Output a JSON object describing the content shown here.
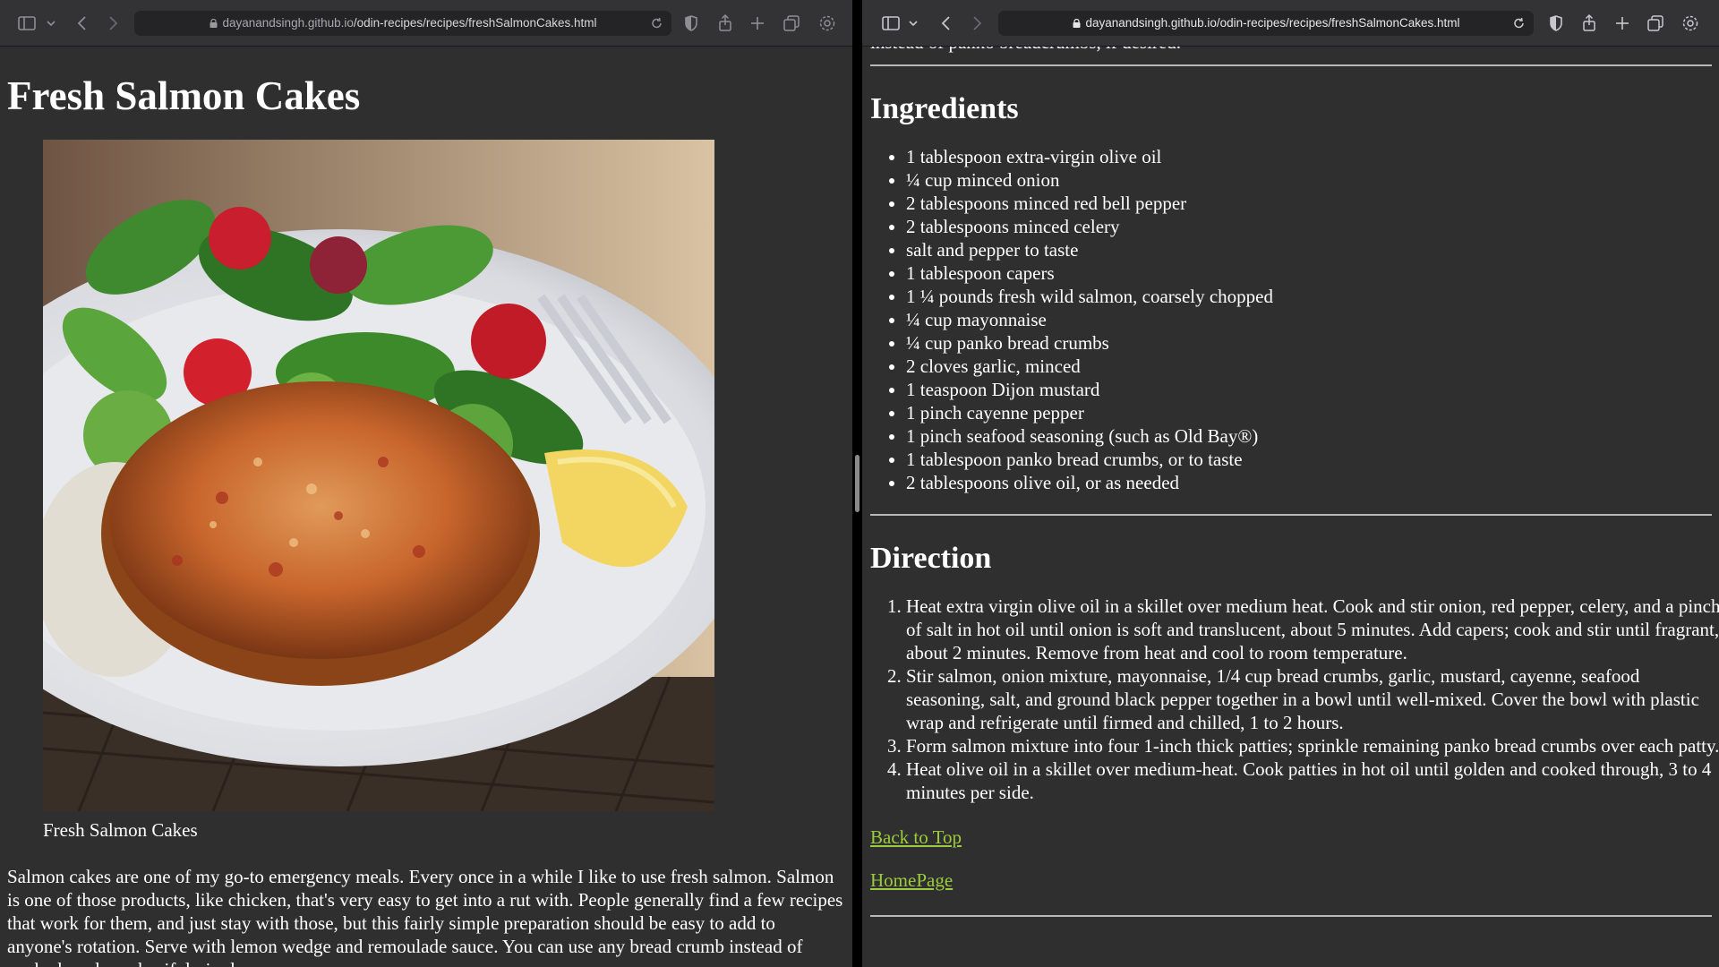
{
  "browser": {
    "left": {
      "url_domain": "dayanandsingh.github.io",
      "url_path": "/odin-recipes/recipes/freshSalmonCakes.html"
    },
    "right": {
      "url_domain": "dayanandsingh.github.io",
      "url_path": "/odin-recipes/recipes/freshSalmonCakes.html"
    }
  },
  "icons": [
    "sidebar-icon",
    "chevron-down-icon",
    "back-icon",
    "forward-icon",
    "lock-icon",
    "reload-icon",
    "shield-icon",
    "share-icon",
    "new-tab-icon",
    "tabs-overview-icon",
    "settings-icon"
  ],
  "colors": {
    "link": "#9ccc3c",
    "page_bg": "#2f2f2f",
    "text": "#ffffff"
  },
  "page": {
    "title": "Fresh Salmon Cakes",
    "image_caption": "Fresh Salmon Cakes",
    "intro": "Salmon cakes are one of my go-to emergency meals. Every once in a while I like to use fresh salmon. Salmon is one of those products, like chicken, that's very easy to get into a rut with. People generally find a few recipes that work for them, and just stay with those, but this fairly simple preparation should be easy to add to anyone's rotation. Serve with lemon wedge and remoulade sauce. You can use any bread crumb instead of panko breadcrumbs, if desired.",
    "intro_tail": "instead of panko breadcrumbs, if desired.",
    "ingredients_heading": "Ingredients",
    "ingredients": [
      "1 tablespoon extra-virgin olive oil",
      "¼ cup minced onion",
      "2 tablespoons minced red bell pepper",
      "2 tablespoons minced celery",
      "salt and pepper to taste",
      "1 tablespoon capers",
      "1 ¼ pounds fresh wild salmon, coarsely chopped",
      "¼ cup mayonnaise",
      "¼ cup panko bread crumbs",
      "2 cloves garlic, minced",
      "1 teaspoon Dijon mustard",
      "1 pinch cayenne pepper",
      "1 pinch seafood seasoning (such as Old Bay®)",
      "1 tablespoon panko bread crumbs, or to taste",
      "2 tablespoons olive oil, or as needed"
    ],
    "direction_heading": "Direction",
    "directions": [
      "Heat extra virgin olive oil in a skillet over medium heat. Cook and stir onion, red pepper, celery, and a pinch of salt in hot oil until onion is soft and translucent, about 5 minutes. Add capers; cook and stir until fragrant, about 2 minutes. Remove from heat and cool to room temperature.",
      "Stir salmon, onion mixture, mayonnaise, 1/4 cup bread crumbs, garlic, mustard, cayenne, seafood seasoning, salt, and ground black pepper together in a bowl until well-mixed. Cover the bowl with plastic wrap and refrigerate until firmed and chilled, 1 to 2 hours.",
      "Form salmon mixture into four 1-inch thick patties; sprinkle remaining panko bread crumbs over each patty.",
      "Heat olive oil in a skillet over medium-heat. Cook patties in hot oil until golden and cooked through, 3 to 4 minutes per side."
    ],
    "back_to_top": "Back to Top",
    "homepage": "HomePage"
  }
}
